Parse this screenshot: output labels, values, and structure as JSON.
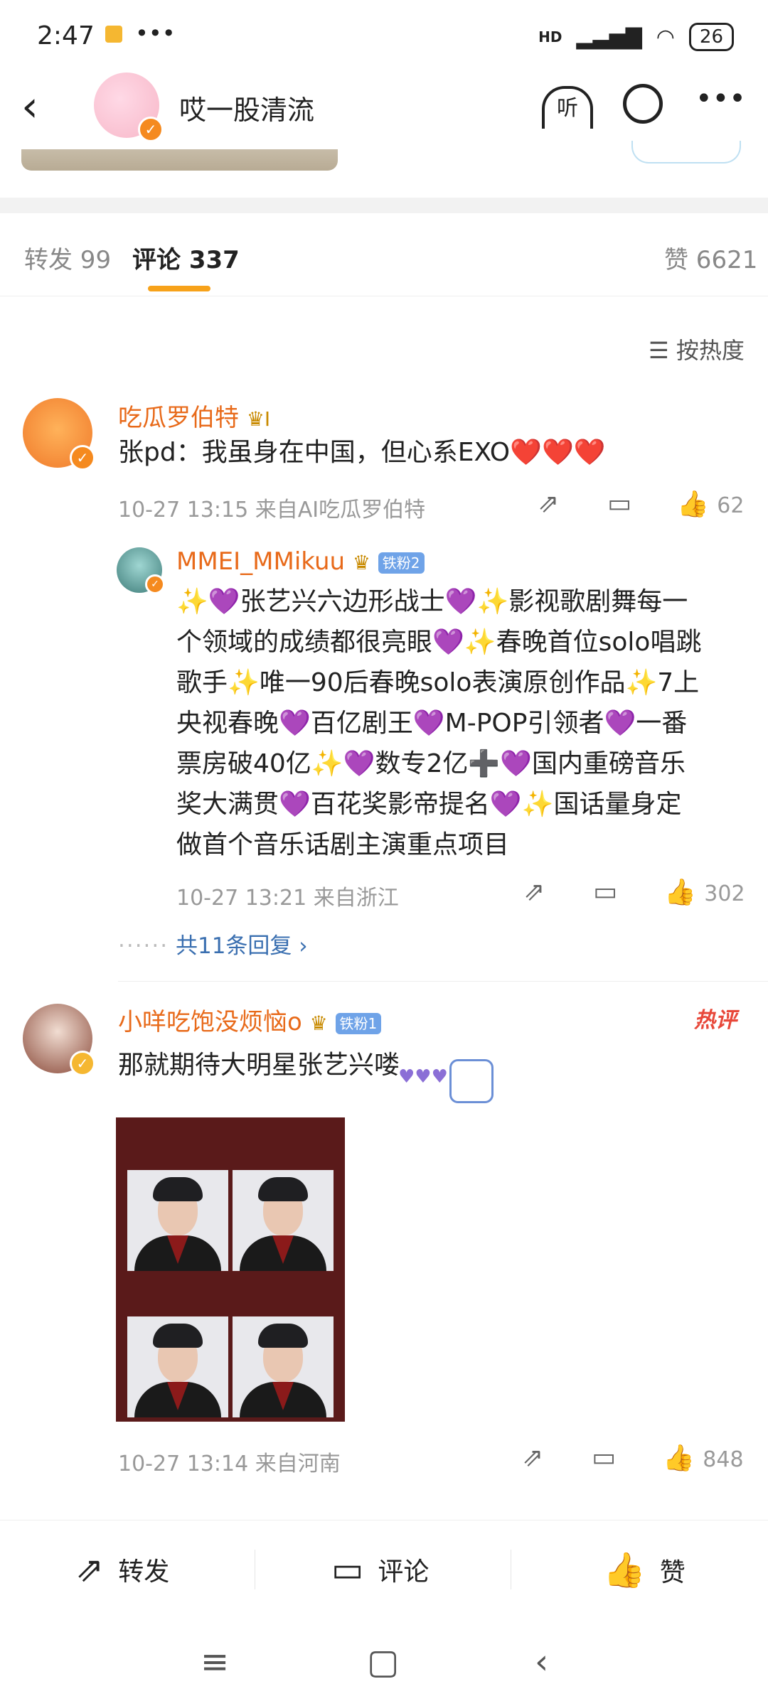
{
  "status": {
    "time": "2:47",
    "network": "HD",
    "battery": "26"
  },
  "header": {
    "title": "哎一股清流",
    "listen_label": "听"
  },
  "tabs": {
    "repost": "转发 99",
    "comments": "评论 337",
    "likes": "赞 6621"
  },
  "sort_label": "按热度",
  "comments": [
    {
      "user": "吃瓜罗伯特",
      "text": "张pd：我虽身在中国，但心系EXO❤️❤️❤️",
      "meta": "10-27 13:15  来自AI吃瓜罗伯特",
      "likes": "62",
      "reply": {
        "user": "MMEI_MMikuu",
        "fan_badge": "铁粉2",
        "lines": [
          "✨💜张艺兴六边形战士💜✨影视歌剧舞每一",
          "个领域的成绩都很亮眼💜✨春晚首位solo唱跳",
          "歌手✨唯一90后春晚solo表演原创作品✨7上",
          "央视春晚💜百亿剧王💜M-POP引领者💜一番",
          "票房破40亿✨💜数专2亿➕💜国内重磅音乐",
          "奖大满贯💜百花奖影帝提名💜✨国话量身定",
          "做首个音乐话剧主演重点项目"
        ],
        "meta": "10-27 13:21  来自浙江",
        "likes": "302"
      },
      "more_replies": "共11条回复"
    },
    {
      "user": "小咩吃饱没烦恼o",
      "fan_badge": "铁粉1",
      "hot_tag": "热评",
      "text": "那就期待大明星张艺兴喽",
      "meta": "10-27 13:14  来自河南",
      "likes": "848"
    }
  ],
  "bottom_bar": {
    "repost": "转发",
    "comment": "评论",
    "like": "赞"
  }
}
